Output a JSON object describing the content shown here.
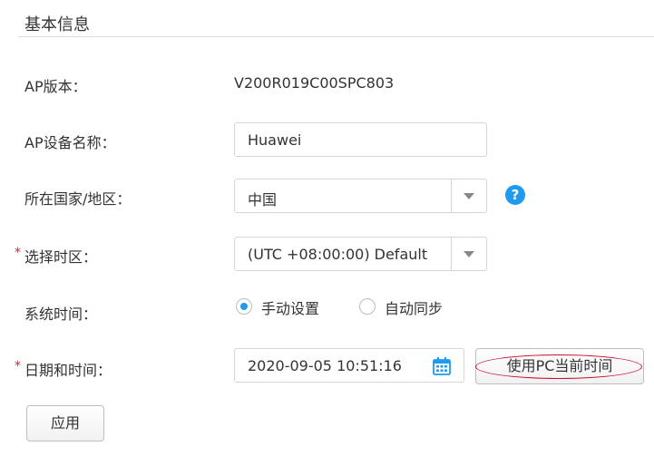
{
  "section": {
    "title": "基本信息"
  },
  "form": {
    "ap_version": {
      "label": "AP版本：",
      "value": "V200R019C00SPC803"
    },
    "device_name": {
      "label": "AP设备名称：",
      "value": "Huawei"
    },
    "country": {
      "label": "所在国家/地区：",
      "value": "中国"
    },
    "timezone": {
      "required_mark": "*",
      "label": "选择时区：",
      "value": "(UTC +08:00:00) Default"
    },
    "system_time": {
      "label": "系统时间：",
      "options": [
        {
          "label": "手动设置",
          "checked": true
        },
        {
          "label": "自动同步",
          "checked": false
        }
      ]
    },
    "datetime": {
      "required_mark": "*",
      "label": "日期和时间：",
      "value": "2020-09-05 10:51:16"
    }
  },
  "buttons": {
    "use_pc_time": "使用PC当前时间",
    "apply": "应用"
  },
  "colors": {
    "accent": "#1e9bf0",
    "required": "#e02020",
    "highlight": "#c8102e"
  },
  "icons": {
    "help": "question-circle-icon",
    "calendar": "calendar-icon",
    "dropdown": "chevron-down-icon"
  }
}
